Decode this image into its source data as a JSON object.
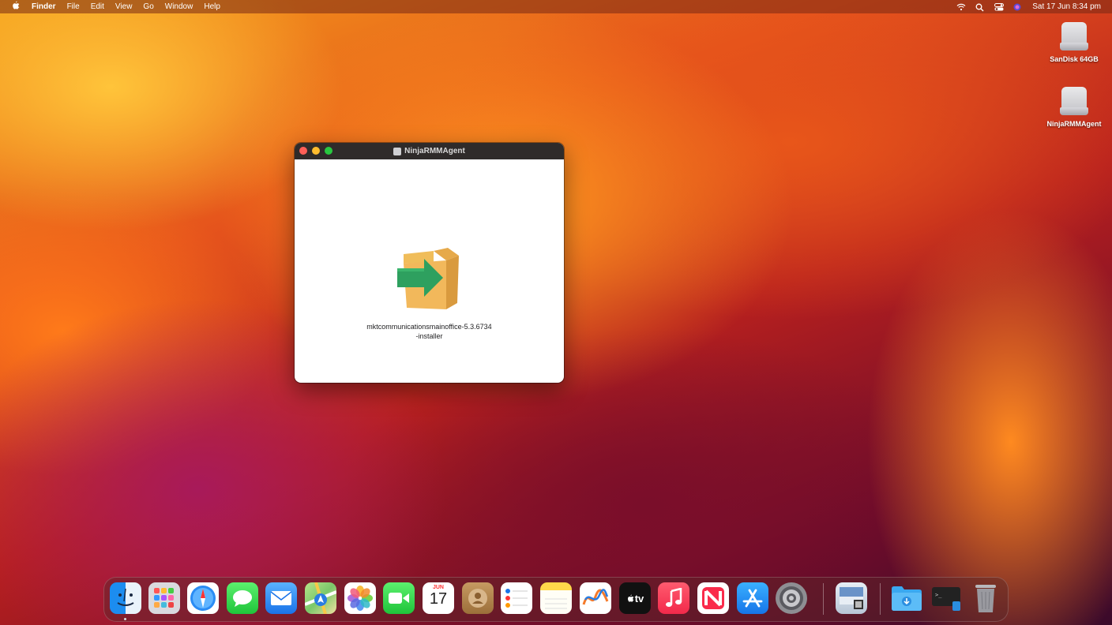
{
  "menubar": {
    "items": [
      "Finder",
      "File",
      "Edit",
      "View",
      "Go",
      "Window",
      "Help"
    ],
    "datetime": "Sat 17 Jun  8:34 pm"
  },
  "desktop": {
    "icons": [
      {
        "label": "SanDisk 64GB"
      },
      {
        "label": "NinjaRMMAgent"
      }
    ]
  },
  "window": {
    "title": "NinjaRMMAgent",
    "file_label": "mktcommunicationsmainoffice-5.3.6734-installer"
  },
  "dock": {
    "calendar_month": "JUN",
    "calendar_day": "17",
    "tv_label": "tv"
  }
}
